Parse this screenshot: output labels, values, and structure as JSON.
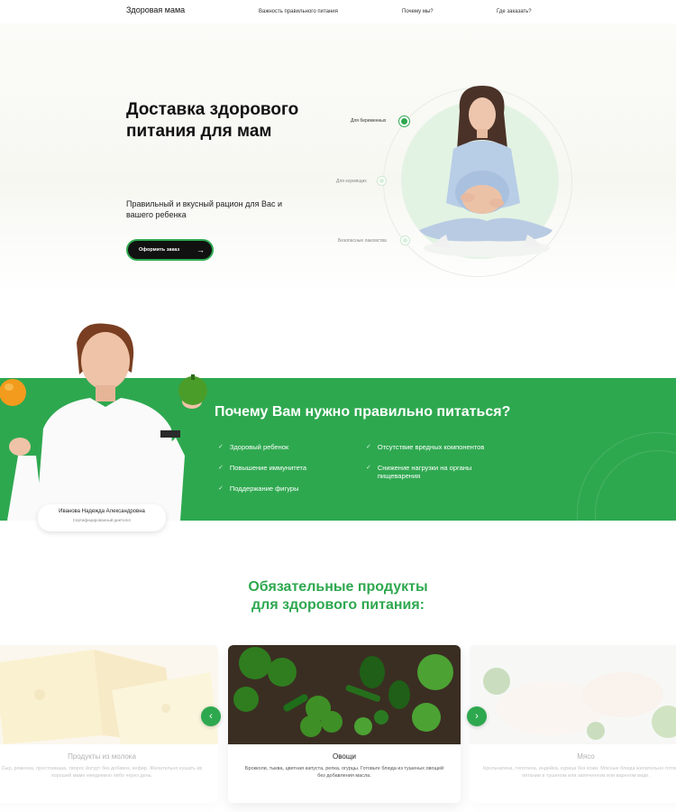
{
  "header": {
    "logo": "Здоровая мама",
    "nav": [
      {
        "label": "Важность правильного питания"
      },
      {
        "label": "Почему мы?"
      },
      {
        "label": "Где заказать?"
      }
    ]
  },
  "hero": {
    "title": "Доставка здорового питания для мам",
    "subtitle": "Правильный и вкусный рацион для Вас и вашего ребенка",
    "cta_label": "Оформить заказ",
    "audience": [
      {
        "label": "Для беременных",
        "active": true
      },
      {
        "label": "Для кормящих",
        "active": false
      },
      {
        "label": "Безопасные лакомства",
        "active": false
      }
    ]
  },
  "why": {
    "title": "Почему Вам нужно правильно питаться?",
    "left_items": [
      "Здоровый ребенок",
      "Повышение иммунитета",
      "Поддержание фигуры"
    ],
    "right_items": [
      "Отсутствие вредных компонентов",
      "Снижение нагрузки на органы пищеварения"
    ],
    "expert": {
      "name": "Иванова Надежда Александровна",
      "role": "Сертифицированный диетолог"
    }
  },
  "products": {
    "title_line1": "Обязательные продукты",
    "title_line2": "для здорового питания:",
    "cards": [
      {
        "title": "Продукты из молока",
        "description": "Сыр, ряженка, простокваша, творог, йогурт без добавок, кефир. Желательно кушать их хорошей маме ежедневно либо через день."
      },
      {
        "title": "Овощи",
        "description": "Брокколи, тыква, цветная капуста, репка, огурцы. Готовьте блюда из тушеных овощей без добавления масла."
      },
      {
        "title": "Мясо",
        "description": "Крольчатина, телятина, индейка, курица без кожи. Мясные блюда желательно готовить в питании в тушеном или запеченном или вареном виде."
      }
    ]
  },
  "colors": {
    "accent": "#2ea84f",
    "dark": "#111111"
  }
}
